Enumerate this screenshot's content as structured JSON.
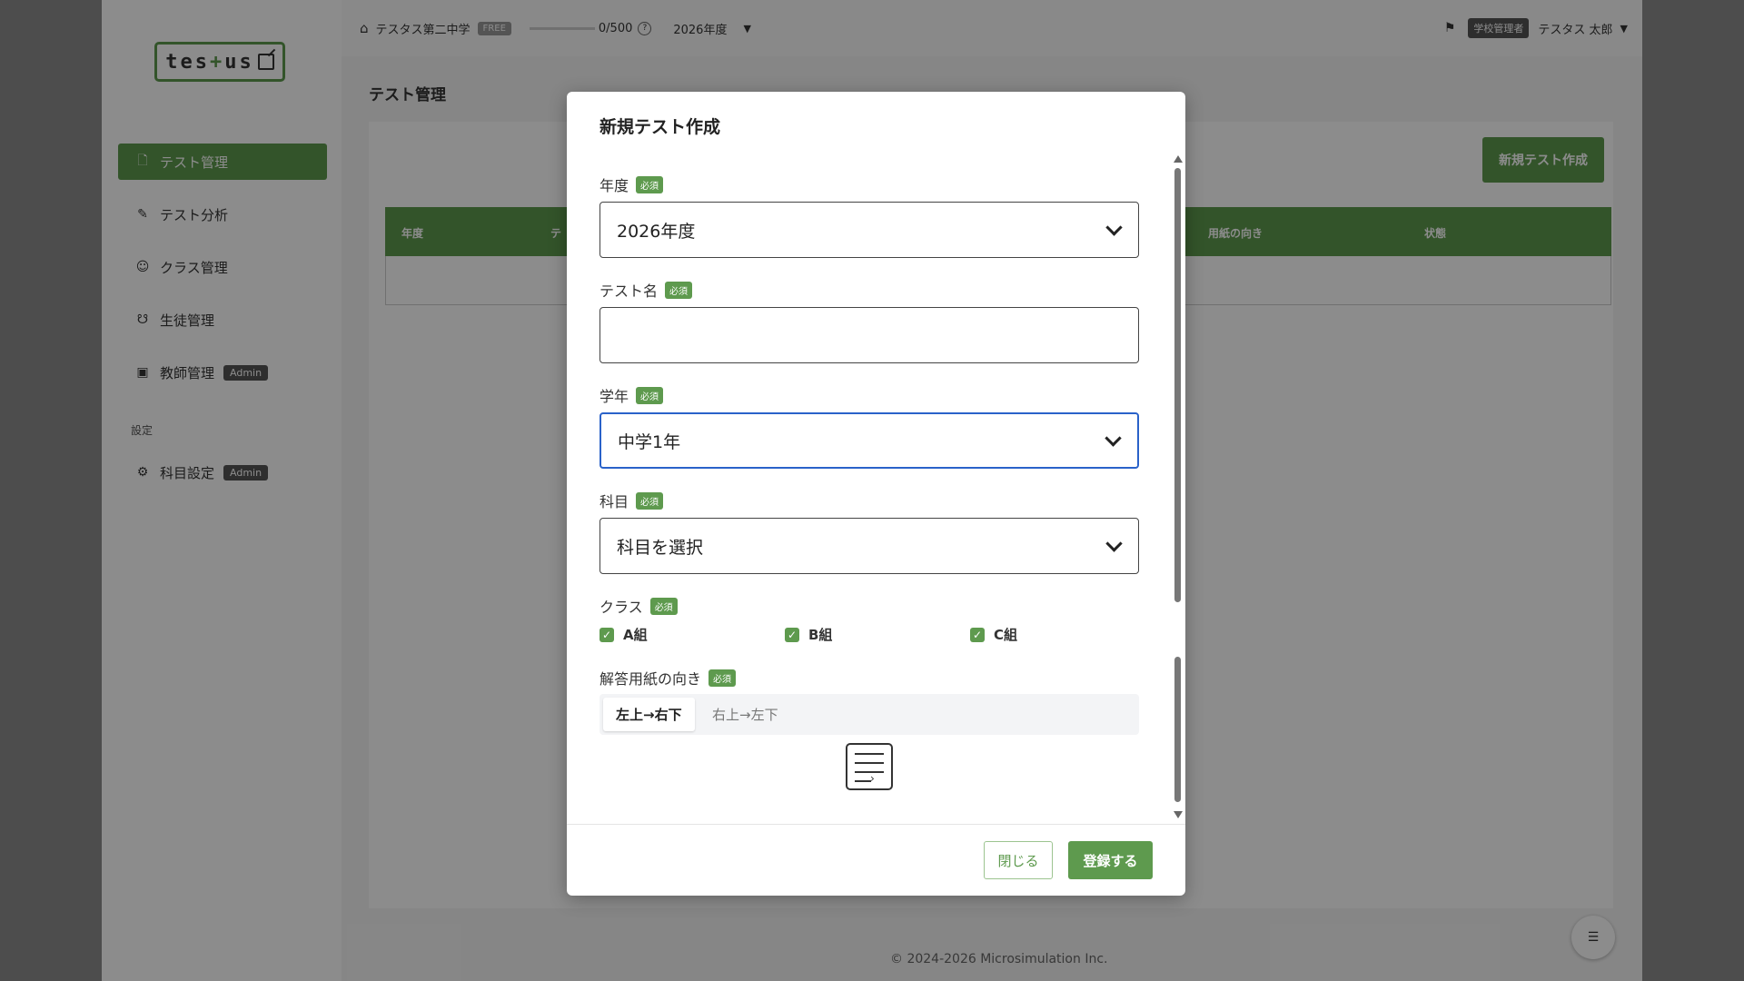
{
  "app": {
    "logo_left": "tes",
    "logo_plus": "+",
    "logo_right": "us"
  },
  "sidebar": {
    "items": [
      {
        "label": "テスト管理",
        "icon": "file-icon",
        "glyph": "🗋",
        "active": true
      },
      {
        "label": "テスト分析",
        "icon": "analysis-icon",
        "glyph": "✎"
      },
      {
        "label": "クラス管理",
        "icon": "class-icon",
        "glyph": "☺"
      },
      {
        "label": "生徒管理",
        "icon": "student-icon",
        "glyph": "☋"
      },
      {
        "label": "教師管理",
        "icon": "teacher-icon",
        "glyph": "▣",
        "badge": "Admin"
      }
    ],
    "section_label": "設定",
    "settings_items": [
      {
        "label": "科目設定",
        "icon": "gear-icon",
        "glyph": "⚙",
        "badge": "Admin"
      }
    ]
  },
  "topbar": {
    "school_name": "テスタス第二中学",
    "plan_badge": "FREE",
    "quota": "0/500",
    "help_glyph": "?",
    "year": "2026年度",
    "role_badge": "学校管理者",
    "user_name": "テスタス 太郎"
  },
  "main": {
    "page_title": "テスト管理",
    "new_test_button": "新規テスト作成",
    "table_headers": [
      "年度",
      "テ",
      "用紙の向き",
      "状態"
    ]
  },
  "modal": {
    "title": "新規テスト作成",
    "required_label": "必須",
    "fields": {
      "year": {
        "label": "年度",
        "value": "2026年度"
      },
      "test_name": {
        "label": "テスト名",
        "value": ""
      },
      "grade": {
        "label": "学年",
        "value": "中学1年"
      },
      "subject": {
        "label": "科目",
        "value": "科目を選択"
      },
      "class": {
        "label": "クラス",
        "options": [
          "A組",
          "B組",
          "C組"
        ]
      },
      "orientation": {
        "label": "解答用紙の向き",
        "options": [
          "左上→右下",
          "右上→左下"
        ]
      }
    },
    "close_button": "閉じる",
    "submit_button": "登録する"
  },
  "footer": {
    "copyright": "© 2024-2026 Microsimulation Inc."
  },
  "colors": {
    "brand": "#5e9a4e",
    "focus": "#2a62c9"
  }
}
